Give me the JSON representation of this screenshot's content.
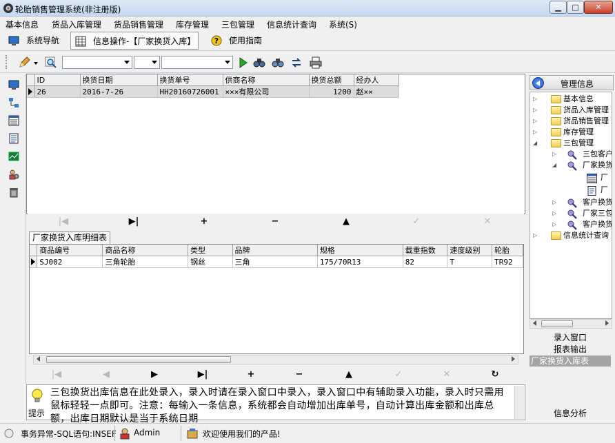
{
  "window": {
    "title": "轮胎销售管理系统(非注册版)",
    "minimize": "▁",
    "maximize": "□",
    "close": "✕"
  },
  "menu": [
    "基本信息",
    "货品入库管理",
    "货品销售管理",
    "库存管理",
    "三包管理",
    "信息统计查询",
    "系统(S)"
  ],
  "tabs": {
    "nav": "系统导航",
    "active": "信息操作-【厂家换货入库】",
    "guide": "使用指南"
  },
  "toolbar": {
    "combo1": "",
    "combo2": "",
    "combo3": ""
  },
  "master_grid": {
    "columns": [
      "ID",
      "换货日期",
      "换货单号",
      "供商名称",
      "换货总额",
      "经办人"
    ],
    "rows": [
      [
        "26",
        "2016-7-26",
        "HH20160726001",
        "×××有限公司",
        "1200",
        "赵××"
      ]
    ]
  },
  "detail": {
    "tab_label": "厂家换货入库明细表",
    "columns": [
      "商品编号",
      "商品名称",
      "类型",
      "品牌",
      "规格",
      "载重指数",
      "速度级别",
      "轮胎"
    ],
    "rows": [
      [
        "SJ002",
        "三角轮胎",
        "钢丝",
        "三角",
        "175/70R13",
        "82",
        "T",
        "TR92"
      ]
    ]
  },
  "hint": {
    "label": "提示",
    "text": "三包换货出库信息在此处录入，录入时请在录入窗口中录入，录入窗口中有辅助录入功能，录入时只需用鼠标轻轻一点即可。注意：每输入一条信息，系统都会自动增加出库单号，自动计算出库金额和出库总额，出库日期默认是当于系统日期"
  },
  "status": {
    "sql": "事务异常-SQL语句:INSEF",
    "user": "Admin",
    "welcome": "欢迎使用我们的产品!"
  },
  "right_panel": {
    "title": "管理信息",
    "tree": [
      {
        "label": "基本信息",
        "level": 0
      },
      {
        "label": "货品入库管理",
        "level": 0
      },
      {
        "label": "货品销售管理",
        "level": 0
      },
      {
        "label": "库存管理",
        "level": 0
      },
      {
        "label": "三包管理",
        "level": 0
      },
      {
        "label": "三包客户",
        "level": 1
      },
      {
        "label": "厂家换货",
        "level": 1
      },
      {
        "label": "厂",
        "level": 2
      },
      {
        "label": "厂",
        "level": 2
      },
      {
        "label": "客户换货",
        "level": 1
      },
      {
        "label": "厂家三包",
        "level": 1
      },
      {
        "label": "客户换货",
        "level": 1
      },
      {
        "label": "信息统计查询",
        "level": 0
      }
    ],
    "buttons": [
      "录入窗口",
      "报表输出",
      "厂家换货入库表",
      "信息分析"
    ]
  },
  "colors": {
    "title_bar": "#c4d8ef",
    "close_button": "#c7402a",
    "selected_row": "#dcdcdc",
    "selected_panel_item": "#a4a4a4",
    "tree_folder": "#f2cf4e"
  }
}
